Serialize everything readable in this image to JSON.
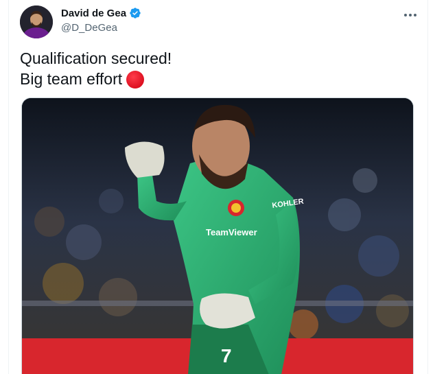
{
  "tweet": {
    "author": {
      "display_name": "David de Gea",
      "handle": "@D_DeGea",
      "verified": true,
      "avatar_icon": "profile-avatar"
    },
    "text_lines": [
      "Qualification secured!",
      "Big team effort"
    ],
    "emoji": "red-circle",
    "more_icon": "more-horizontal-icon",
    "media": {
      "type": "photo",
      "jersey_text": [
        "TeamViewer",
        "KOHLER",
        "7"
      ]
    }
  },
  "colors": {
    "verified_blue": "#1d9bf0",
    "secondary_text": "#536471",
    "primary_text": "#0f1419",
    "emoji_red": "#dd1020",
    "jersey_green": "#2fae72"
  }
}
